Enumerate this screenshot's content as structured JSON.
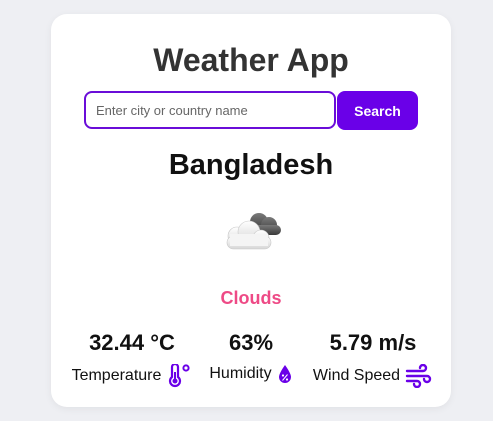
{
  "app": {
    "title": "Weather App"
  },
  "search": {
    "placeholder": "Enter city or country name",
    "value": "",
    "button_label": "Search"
  },
  "weather": {
    "location": "Bangladesh",
    "icon": "clouds-icon",
    "condition": "Clouds"
  },
  "stats": {
    "temperature": {
      "value": "32.44 °C",
      "label": "Temperature",
      "icon": "thermometer-icon"
    },
    "humidity": {
      "value": "63%",
      "label": "Humidity",
      "icon": "humidity-drop-icon"
    },
    "wind": {
      "value": "5.79 m/s",
      "label": "Wind Speed",
      "icon": "wind-icon"
    }
  },
  "colors": {
    "accent": "#6a00e8",
    "condition": "#ee4a86",
    "background": "#eeeff3",
    "card": "#ffffff"
  }
}
